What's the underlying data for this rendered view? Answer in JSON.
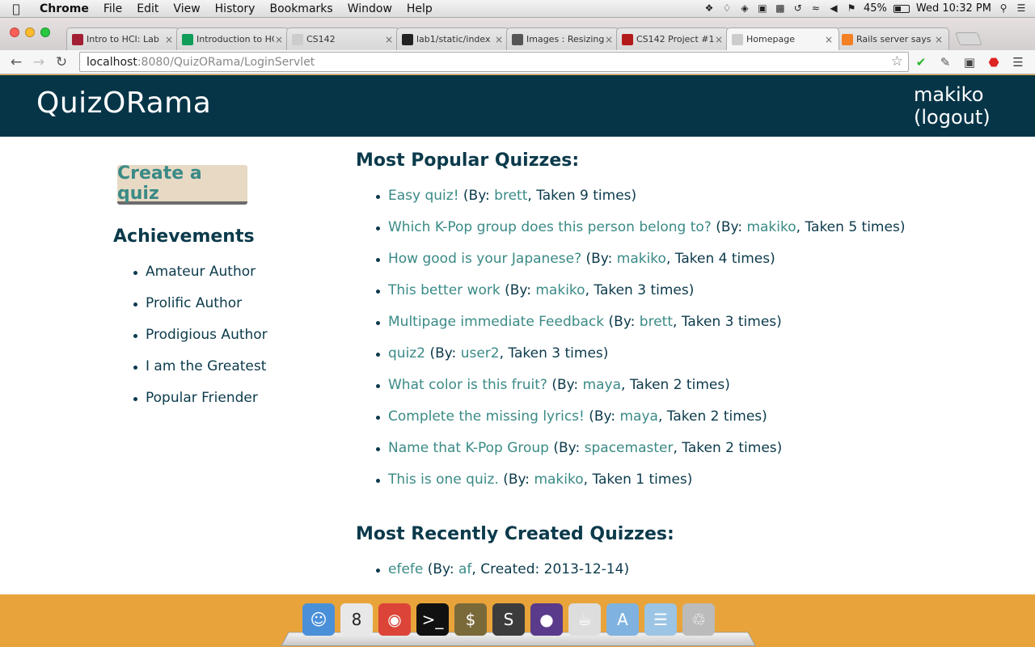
{
  "menubar": {
    "app": "Chrome",
    "menus": [
      "File",
      "Edit",
      "View",
      "History",
      "Bookmarks",
      "Window",
      "Help"
    ],
    "battery": "45%",
    "clock": "Wed 10:32 PM"
  },
  "tabs": [
    {
      "label": "Intro to HCI: Lab",
      "icon": "stanford-icon",
      "color": "#a31f34"
    },
    {
      "label": "Introduction to HCI",
      "icon": "sheets-icon",
      "color": "#0f9d58"
    },
    {
      "label": "CS142",
      "icon": "page-icon",
      "color": "#cccccc"
    },
    {
      "label": "lab1/static/index",
      "icon": "github-icon",
      "color": "#222222"
    },
    {
      "label": "Images : Resizing",
      "icon": "images-icon",
      "color": "#555555"
    },
    {
      "label": "CS142 Project #1",
      "icon": "s-icon",
      "color": "#b31b1b"
    },
    {
      "label": "Homepage",
      "icon": "page-icon",
      "color": "#cccccc"
    },
    {
      "label": "Rails server says",
      "icon": "stackoverflow-icon",
      "color": "#f48024"
    }
  ],
  "toolbar": {
    "url_host": "localhost",
    "url_rest": ":8080/QuizORama/LoginServlet"
  },
  "site": {
    "brand": "QuizORama",
    "username": "makiko",
    "logout": "(logout)",
    "create_button": "Create a quiz",
    "achievements_title": "Achievements",
    "achievements": [
      "Amateur Author",
      "Prolific Author",
      "Prodigious Author",
      "I am the Greatest",
      "Popular Friender"
    ],
    "popular_title": "Most Popular Quizzes:",
    "popular": [
      {
        "title": "Easy quiz!",
        "author": "brett",
        "taken": "Taken 9 times"
      },
      {
        "title": "Which K-Pop group does this person belong to?",
        "author": "makiko",
        "taken": "Taken 5 times"
      },
      {
        "title": "How good is your Japanese?",
        "author": "makiko",
        "taken": "Taken 4 times"
      },
      {
        "title": "This better work",
        "author": "makiko",
        "taken": "Taken 3 times"
      },
      {
        "title": "Multipage immediate Feedback",
        "author": "brett",
        "taken": "Taken 3 times"
      },
      {
        "title": "quiz2",
        "author": "user2",
        "taken": "Taken 3 times"
      },
      {
        "title": "What color is this fruit?",
        "author": "maya",
        "taken": "Taken 2 times"
      },
      {
        "title": "Complete the missing lyrics!",
        "author": "maya",
        "taken": "Taken 2 times"
      },
      {
        "title": "Name that K-Pop Group",
        "author": "spacemaster",
        "taken": "Taken 2 times"
      },
      {
        "title": "This is one quiz.",
        "author": "makiko",
        "taken": "Taken 1 times"
      }
    ],
    "recent_title": "Most Recently Created Quizzes:",
    "recent": [
      {
        "title": "efefe",
        "author": "af",
        "created": "Created: 2013-12-14"
      }
    ],
    "by_prefix": "(By: ",
    "colors": {
      "header": "#063548",
      "link": "#3a8a86",
      "text": "#0b3a4b",
      "button": "#e7d9c4"
    }
  },
  "dock": {
    "calendar_day": "8",
    "items": [
      {
        "name": "finder-icon",
        "color": "#4a90d9"
      },
      {
        "name": "calendar-icon",
        "color": "#e8e8e8"
      },
      {
        "name": "chrome-icon",
        "color": "#db4437"
      },
      {
        "name": "terminal-icon",
        "color": "#111111"
      },
      {
        "name": "money-app-icon",
        "color": "#7a6a3a"
      },
      {
        "name": "sublime-text-icon",
        "color": "#3c3c3c"
      },
      {
        "name": "eclipse-icon",
        "color": "#5a3a8a"
      },
      {
        "name": "preview-icon",
        "color": "#dddddd"
      },
      {
        "name": "applications-folder-icon",
        "color": "#7fb2de"
      },
      {
        "name": "documents-folder-icon",
        "color": "#9cc4e4"
      },
      {
        "name": "trash-icon",
        "color": "#bbbbbb"
      }
    ]
  }
}
